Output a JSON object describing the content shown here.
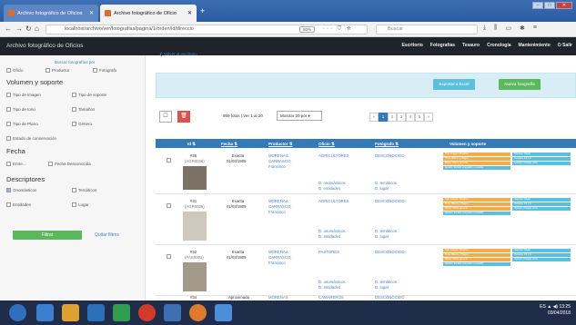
{
  "browser": {
    "tabs": [
      {
        "label": "Archivo fotográfico de Oficios"
      },
      {
        "label": "Archivo fotográfico de Oficio"
      }
    ],
    "new_tab": "+",
    "url": "localhost/archivo/ver/fotografias/pagina/1/orden/id/direccio",
    "zoom": "80%",
    "url_dots": "··· ⛉ ☆",
    "search_placeholder": "Buscar"
  },
  "app": {
    "title": "Archivo fotográfico de Oficios",
    "menu": [
      "Escritorio",
      "Fotografías",
      "Tesauro",
      "Cronología",
      "Mantenimiento",
      "Salir"
    ]
  },
  "sidebar": {
    "search_label": "Buscar fotografías por",
    "row1": [
      "Oficio",
      "Productor",
      "Fotógrafo"
    ],
    "section1": "Volumen y soporte",
    "vol": [
      "Tipo de imagen",
      "Tipo de soporte",
      "Tipo de tono",
      "Tamaños",
      "Tipo de Plano",
      "Género",
      "Estado de conservación"
    ],
    "section2": "Fecha",
    "fecha": [
      "Entre...",
      "Fecha Desconocida"
    ],
    "section3": "Descriptores",
    "desc": [
      "Onomásticos",
      "Temáticos",
      "Entidades",
      "Lugar"
    ],
    "filter_button": "Filtrar",
    "clear_link": "Quitar filtros"
  },
  "main": {
    "back_link": "Volver al escritorio",
    "export_button": "Exportar a Excel",
    "new_button": "Nueva fotografía",
    "total": "959 fotos | Ver 1 al 20",
    "per_page": "Mostrar 20 por",
    "pager": [
      "«",
      "1",
      "2",
      "3",
      "4",
      "5",
      "»"
    ],
    "columns": [
      "Id",
      "Fecha",
      "Productor",
      "Oficio",
      "Fotógrafo",
      "Volumen y soporte"
    ],
    "rows": [
      {
        "id": "#36",
        "code": "(AGR0036)",
        "fecha_tipo": "Exacta",
        "fecha": "01/03/1905",
        "productor": "MORENAS CARRASCO, Francisco",
        "oficio": "AGRICULTORES",
        "fotografo": "DESCONOCIDO",
        "d1": "D. onomásticos",
        "d2": "D. temáticos",
        "d3": "D. entidades",
        "d4": "D. lugar"
      },
      {
        "id": "#31",
        "code": "(AGR0035)",
        "fecha_tipo": "Exacta",
        "fecha": "01/03/1905",
        "productor": "MORENAS CARRASCO, Francisco",
        "oficio": "AGRICULTORES",
        "fotografo": "DESCONOCIDO",
        "d1": "D. onomásticos",
        "d2": "D. temáticos",
        "d3": "D. entidades",
        "d4": "D. lugar"
      },
      {
        "id": "#32",
        "code": "(PAS0001)",
        "fecha_tipo": "Exacta",
        "fecha": "01/03/1905",
        "productor": "MORENAS CARRASCO, Francisco",
        "oficio": "PASTORES",
        "fotografo": "DESCONOCIDO",
        "d1": "D. onomásticos",
        "d2": "D. temáticos",
        "d3": "D. entidades",
        "d4": "D. lugar"
      },
      {
        "id": "#34",
        "code": "",
        "fecha_tipo": "Aproximada",
        "fecha": "",
        "productor": "MORENAS",
        "oficio": "CAMAREROS",
        "fotografo": "DESCONOCIDO",
        "d1": "",
        "d2": "",
        "d3": "",
        "d4": ""
      }
    ],
    "tags": {
      "a": "Tipo imagen: Positivo",
      "b": "Soporte: Papel",
      "c": "Tono: Blanco y Negro",
      "d": "Tamaño: 13 x 9",
      "e": "Plano: Plano general",
      "f": "Género: Paisaje rural",
      "g": "Estado: Estado aceptable o estable"
    }
  },
  "taskbar": {
    "lang": "ES",
    "time": "13:25",
    "date": "03/04/2018"
  }
}
